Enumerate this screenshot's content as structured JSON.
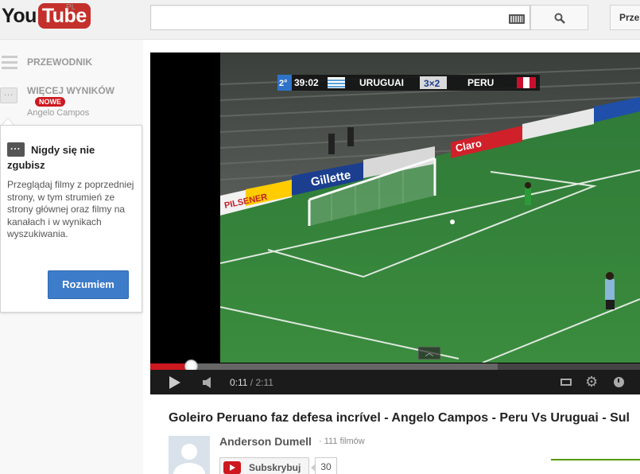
{
  "header": {
    "logo_you": "You",
    "logo_tube": "Tube",
    "region": "PL",
    "search_placeholder": "",
    "upload_label": "Prześlij"
  },
  "sidebar": {
    "guide_label": "PRZEWODNIK",
    "more_results_label": "WIĘCEJ WYNIKÓW",
    "new_badge": "NOWE",
    "sub_label": "Angelo Campos"
  },
  "tooltip": {
    "title": "Nigdy się nie zgubisz",
    "body": "Przeglądaj filmy z poprzedniej strony, w tym strumień ze strony głównej oraz filmy na kanałach i w wynikach wyszukiwania.",
    "button": "Rozumiem"
  },
  "scoreboard": {
    "period": "2°",
    "clock": "39:02",
    "team_home": "URUGUAI",
    "score": "3×2",
    "team_away": "PERU",
    "ad_board_1": "Claro",
    "ad_board_2": "Gillette",
    "ad_board_3": "PILSENER"
  },
  "player": {
    "current_time": "0:11",
    "separator": " / ",
    "duration": "2:11",
    "played_fraction": 0.084,
    "buffered_fraction": 0.71
  },
  "video": {
    "title": "Goleiro Peruano faz defesa incrível - Angelo Campos - Peru Vs Uruguai - Sul",
    "channel": "Anderson Dumell",
    "video_count_sep": "·",
    "video_count": "111 filmów",
    "subscribe_label": "Subskrybuj",
    "subscriber_count": "30"
  },
  "colors": {
    "brand_red": "#cc181e",
    "button_blue": "#3d7cc9",
    "like_green": "#559900"
  }
}
